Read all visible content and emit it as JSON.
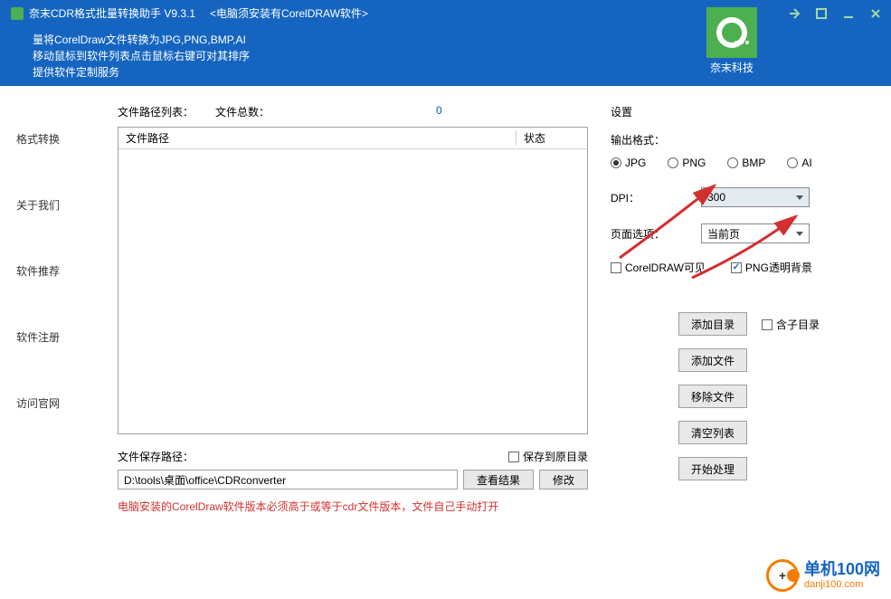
{
  "header": {
    "title": "奈末CDR格式批量转换助手  V9.3.1",
    "subtitle": "<电脑须安装有CorelDRAW软件>",
    "desc_line1": "量将CorelDraw文件转换为JPG,PNG,BMP,AI",
    "desc_line2": "移动鼠标到软件列表点击鼠标右键可对其排序",
    "desc_line3": "提供软件定制服务",
    "logo_text": "奈末科技"
  },
  "sidebar": {
    "items": [
      "格式转换",
      "关于我们",
      "软件推荐",
      "软件注册",
      "访问官网"
    ]
  },
  "main": {
    "list_label": "文件路径列表：",
    "count_label": "文件总数：",
    "count_value": "0",
    "th_path": "文件路径",
    "th_status": "状态",
    "save_label": "文件保存路径：",
    "save_origin": "保存到原目录",
    "save_path": "D:\\tools\\桌面\\office\\CDRconverter",
    "view_btn": "查看结果",
    "modify_btn": "修改",
    "warning": "电脑安装的CorelDraw软件版本必须高于或等于cdr文件版本，文件自己手动打开"
  },
  "settings": {
    "title": "设置",
    "format_label": "输出格式：",
    "formats": [
      "JPG",
      "PNG",
      "BMP",
      "AI"
    ],
    "format_selected": "JPG",
    "dpi_label": "DPI：",
    "dpi_value": "300",
    "page_label": "页面选项：",
    "page_value": "当前页",
    "cb_visible": "CorelDRAW可见",
    "cb_png_alpha": "PNG透明背景",
    "subdir": "含子目录"
  },
  "actions": {
    "add_dir": "添加目录",
    "add_file": "添加文件",
    "remove_file": "移除文件",
    "clear_list": "清空列表",
    "start": "开始处理"
  },
  "watermark": {
    "cn": "单机100网",
    "url": "danji100.com"
  }
}
